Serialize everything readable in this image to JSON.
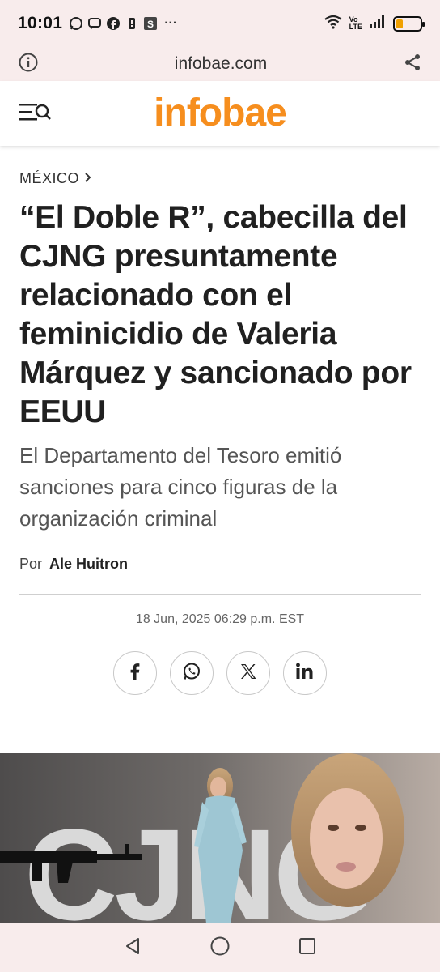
{
  "status_bar": {
    "time": "10:01",
    "network_top": "Vo",
    "network_bottom": "LTE",
    "battery_level": 0.3
  },
  "browser": {
    "url": "infobae.com"
  },
  "site": {
    "logo": "infobae"
  },
  "article": {
    "section": "MÉXICO",
    "headline": "“El Doble R”, cabecilla del CJNG presuntamente relacionado con el feminicidio de Valeria Márquez y sancionado por EEUU",
    "subheadline": "El Departamento del Tesoro emitió sanciones para cinco figuras de la organización criminal",
    "byline_prefix": "Por",
    "author": "Ale Huitron",
    "date": "18 Jun, 2025 06:29 p.m. EST"
  },
  "share_buttons": [
    "facebook-icon",
    "whatsapp-icon",
    "x-icon",
    "linkedin-icon"
  ],
  "hero_image": {
    "overlay_text": "CJNG"
  },
  "colors": {
    "brand": "#f68e1e",
    "status_bg": "#f8ecec",
    "battery": "#f0a000"
  }
}
